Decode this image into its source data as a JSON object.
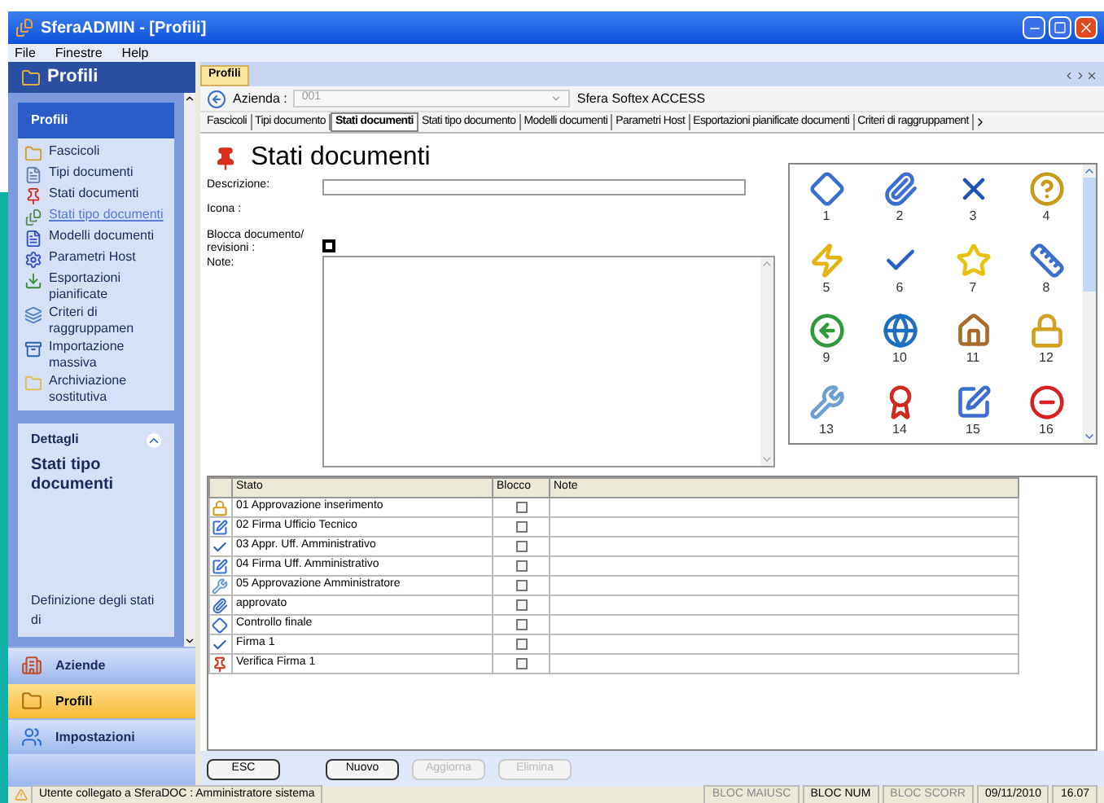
{
  "window": {
    "title": "SferaADMIN - [Profili]"
  },
  "menu": [
    "File",
    "Finestre",
    "Help"
  ],
  "sidebar": {
    "header": "Profili",
    "group": {
      "title": "Profili",
      "items": [
        {
          "label": "Fascicoli",
          "highlighted": false
        },
        {
          "label": "Tipi documenti",
          "highlighted": false
        },
        {
          "label": "Stati documenti",
          "highlighted": false
        },
        {
          "label": "Stati tipo documenti",
          "highlighted": true
        },
        {
          "label": "Modelli documenti",
          "highlighted": false
        },
        {
          "label": "Parametri Host",
          "highlighted": false
        },
        {
          "label": "Esportazioni pianificate",
          "highlighted": false
        },
        {
          "label": "Criteri di raggruppamen",
          "highlighted": false
        },
        {
          "label": "Importazione massiva",
          "highlighted": false
        },
        {
          "label": "Archiviazione sostitutiva",
          "highlighted": false
        }
      ]
    },
    "details": {
      "title": "Dettagli",
      "heading": "Stati tipo documenti",
      "text": "Definizione degli stati di"
    },
    "nav": [
      {
        "label": "Aziende",
        "selected": false
      },
      {
        "label": "Profili",
        "selected": true
      },
      {
        "label": "Impostazioni",
        "selected": false
      }
    ]
  },
  "document_tab": {
    "label": "Profili"
  },
  "azienda": {
    "label": "Azienda :",
    "value": "001",
    "company": "Sfera Softex ACCESS"
  },
  "tabs": [
    {
      "label": "Fascicoli",
      "selected": false
    },
    {
      "label": "Tipi documento",
      "selected": false
    },
    {
      "label": "Stati documenti",
      "selected": true
    },
    {
      "label": "Stati tipo documento",
      "selected": false
    },
    {
      "label": "Modelli documenti",
      "selected": false
    },
    {
      "label": "Parametri Host",
      "selected": false
    },
    {
      "label": "Esportazioni pianificate documenti",
      "selected": false
    },
    {
      "label": "Criteri di raggruppament",
      "selected": false
    }
  ],
  "page_title": "Stati documenti",
  "form": {
    "descrizione_label": "Descrizione:",
    "icona_label": "Icona :",
    "blocca_label": "Blocca documento/ revisioni :",
    "blocca_checked": false,
    "note_label": "Note:"
  },
  "icon_grid": [
    "1",
    "2",
    "3",
    "4",
    "5",
    "6",
    "7",
    "8",
    "9",
    "10",
    "11",
    "12",
    "13",
    "14",
    "15",
    "16"
  ],
  "table": {
    "columns": [
      "Stato",
      "Blocco",
      "Note"
    ],
    "rows": [
      {
        "stato": "01 Approvazione inserimento",
        "blocco": false
      },
      {
        "stato": "02 Firma Ufficio Tecnico",
        "blocco": false
      },
      {
        "stato": "03 Appr. Uff. Amministrativo",
        "blocco": false
      },
      {
        "stato": "04 Firma Uff. Amministrativo",
        "blocco": false
      },
      {
        "stato": "05 Approvazione Amministratore",
        "blocco": false
      },
      {
        "stato": "approvato",
        "blocco": false
      },
      {
        "stato": "Controllo finale",
        "blocco": false
      },
      {
        "stato": "Firma 1",
        "blocco": false
      },
      {
        "stato": "Verifica Firma 1",
        "blocco": false
      }
    ]
  },
  "buttons": [
    {
      "label": "ESC",
      "disabled": false
    },
    {
      "label": "Nuovo",
      "disabled": false
    },
    {
      "label": "Aggiorna",
      "disabled": true
    },
    {
      "label": "Elimina",
      "disabled": true
    }
  ],
  "status_bar": {
    "message": "Utente collegato a SferaDOC : Amministratore sistema",
    "indicators": [
      {
        "label": "BLOC MAIUSC",
        "on": false
      },
      {
        "label": "BLOC NUM",
        "on": true
      },
      {
        "label": "BLOC SCORR",
        "on": false
      }
    ],
    "date": "09/11/2010",
    "time": "16.07"
  }
}
